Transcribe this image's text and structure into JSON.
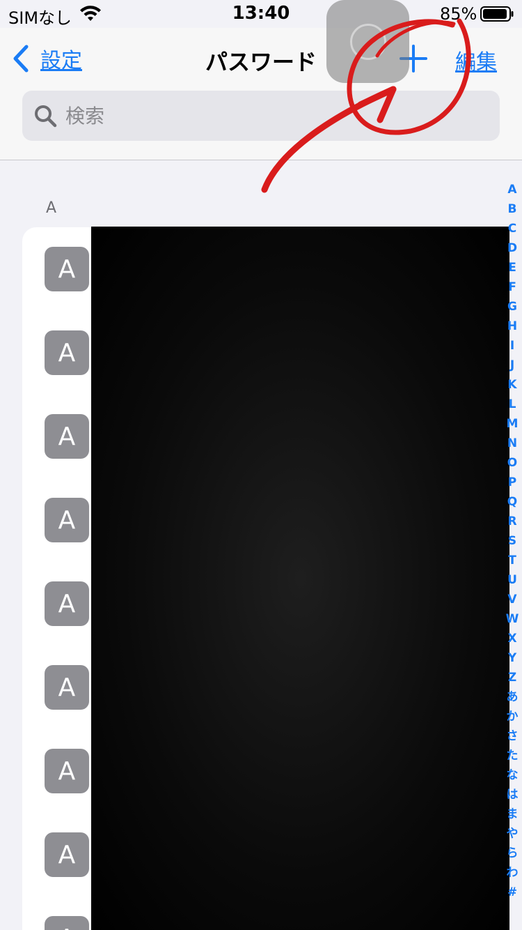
{
  "status_bar": {
    "carrier": "SIMなし",
    "time": "13:40",
    "battery": "85%"
  },
  "nav": {
    "back_label": "設定",
    "title": "パスワード",
    "edit_label": "編集"
  },
  "search": {
    "placeholder": "検索"
  },
  "section": {
    "header": "A"
  },
  "list_items": [
    "A",
    "A",
    "A",
    "A",
    "A",
    "A",
    "A",
    "A",
    "A"
  ],
  "section_index": [
    "A",
    "B",
    "C",
    "D",
    "E",
    "F",
    "G",
    "H",
    "I",
    "J",
    "K",
    "L",
    "M",
    "N",
    "O",
    "P",
    "Q",
    "R",
    "S",
    "T",
    "U",
    "V",
    "W",
    "X",
    "Y",
    "Z",
    "あ",
    "か",
    "さ",
    "た",
    "な",
    "は",
    "ま",
    "や",
    "ら",
    "わ",
    "#"
  ],
  "colors": {
    "accent": "#1a7cf5",
    "icon_gray": "#8e8e93",
    "annotation_red": "#d91c1c"
  }
}
